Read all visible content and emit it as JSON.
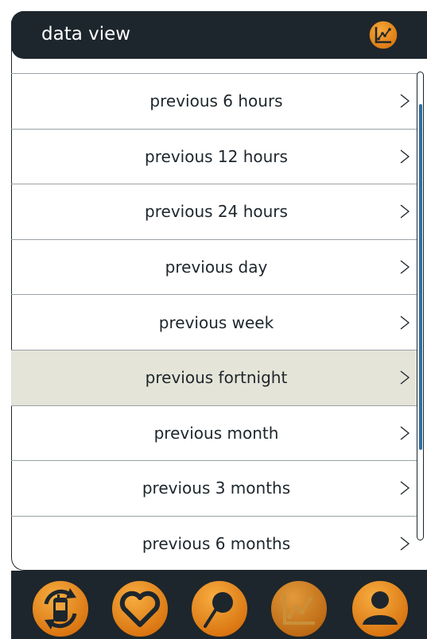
{
  "header": {
    "title": "data view",
    "icon": "chart-icon"
  },
  "list": {
    "items": [
      {
        "label": "previous 6 hours"
      },
      {
        "label": "previous 12 hours"
      },
      {
        "label": "previous 24 hours"
      },
      {
        "label": "previous day"
      },
      {
        "label": "previous week"
      },
      {
        "label": "previous fortnight",
        "selected": true
      },
      {
        "label": "previous month"
      },
      {
        "label": "previous 3 months"
      },
      {
        "label": "previous 6 months"
      }
    ]
  },
  "bottom_nav": {
    "items": [
      {
        "icon": "phone-sync-icon",
        "active": false
      },
      {
        "icon": "heart-icon",
        "active": false
      },
      {
        "icon": "pin-icon",
        "active": false
      },
      {
        "icon": "chart-icon",
        "active": true
      },
      {
        "icon": "user-icon",
        "active": false
      }
    ]
  },
  "colors": {
    "header_bg": "#1d262c",
    "accent_orange": "#e98a1d",
    "selected_row": "#e5e4d8",
    "scroll_thumb": "#2f6f9f"
  }
}
